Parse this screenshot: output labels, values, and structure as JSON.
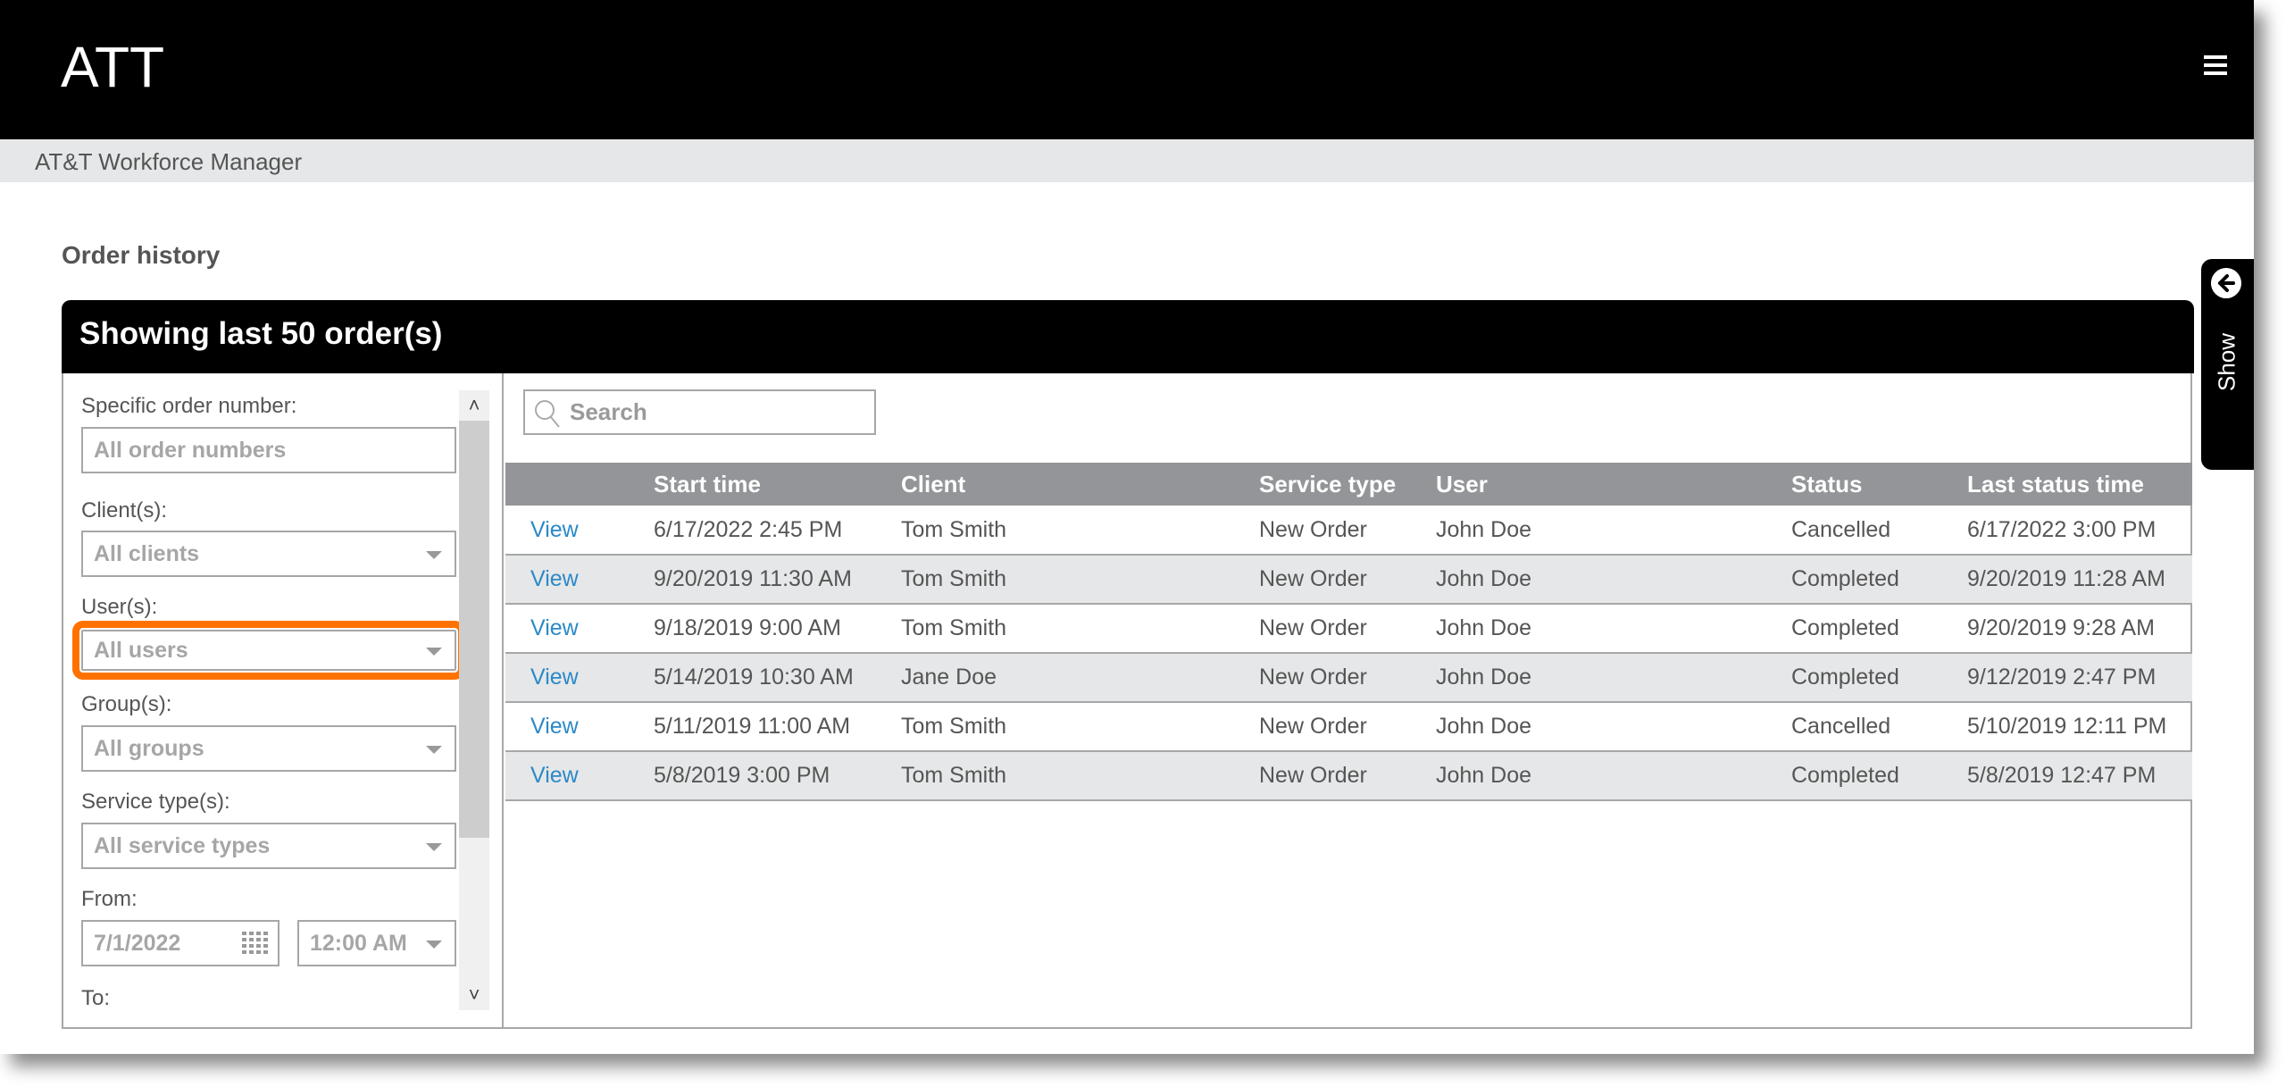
{
  "header": {
    "brand": "ATT",
    "menu_icon": "hamburger-menu-icon",
    "app_name": "AT&T Workforce Manager"
  },
  "page": {
    "title": "Order history"
  },
  "panel": {
    "title": "Showing last 50 order(s)"
  },
  "filters": {
    "order_number": {
      "label": "Specific order number:",
      "placeholder": "All order numbers"
    },
    "clients": {
      "label": "Client(s):",
      "value": "All clients"
    },
    "users": {
      "label": "User(s):",
      "value": "All users",
      "highlighted": true,
      "highlight_color": "#ff7200"
    },
    "groups": {
      "label": "Group(s):",
      "value": "All groups"
    },
    "service_types": {
      "label": "Service type(s):",
      "value": "All service types"
    },
    "from": {
      "label": "From:",
      "date": "7/1/2022",
      "time": "12:00 AM"
    },
    "to": {
      "label": "To:"
    }
  },
  "search": {
    "placeholder": "Search"
  },
  "table": {
    "columns": [
      "",
      "Start time",
      "Client",
      "Service type",
      "User",
      "Status",
      "Last status time"
    ],
    "rows": [
      {
        "action": "View",
        "start_time": "6/17/2022 2:45 PM",
        "client": "Tom Smith",
        "service_type": "New Order",
        "user": "John Doe",
        "status": "Cancelled",
        "last_status_time": "6/17/2022 3:00 PM"
      },
      {
        "action": "View",
        "start_time": "9/20/2019 11:30 AM",
        "client": "Tom Smith",
        "service_type": "New Order",
        "user": "John Doe",
        "status": "Completed",
        "last_status_time": "9/20/2019 11:28 AM"
      },
      {
        "action": "View",
        "start_time": "9/18/2019 9:00 AM",
        "client": "Tom Smith",
        "service_type": "New Order",
        "user": "John Doe",
        "status": "Completed",
        "last_status_time": "9/20/2019 9:28 AM"
      },
      {
        "action": "View",
        "start_time": "5/14/2019 10:30 AM",
        "client": "Jane Doe",
        "service_type": "New Order",
        "user": "John Doe",
        "status": "Completed",
        "last_status_time": "9/12/2019 2:47 PM"
      },
      {
        "action": "View",
        "start_time": "5/11/2019 11:00 AM",
        "client": "Tom Smith",
        "service_type": "New Order",
        "user": "John Doe",
        "status": "Cancelled",
        "last_status_time": "5/10/2019 12:11 PM"
      },
      {
        "action": "View",
        "start_time": "5/8/2019 3:00 PM",
        "client": "Tom Smith",
        "service_type": "New Order",
        "user": "John Doe",
        "status": "Completed",
        "last_status_time": "5/8/2019 12:47 PM"
      }
    ]
  },
  "side_tab": {
    "label": "Show",
    "icon": "arrow-left-circle-icon"
  },
  "colors": {
    "link": "#2b89c8",
    "highlight": "#ff7200",
    "table_header": "#939598",
    "row_alt": "#e6e7e8"
  }
}
